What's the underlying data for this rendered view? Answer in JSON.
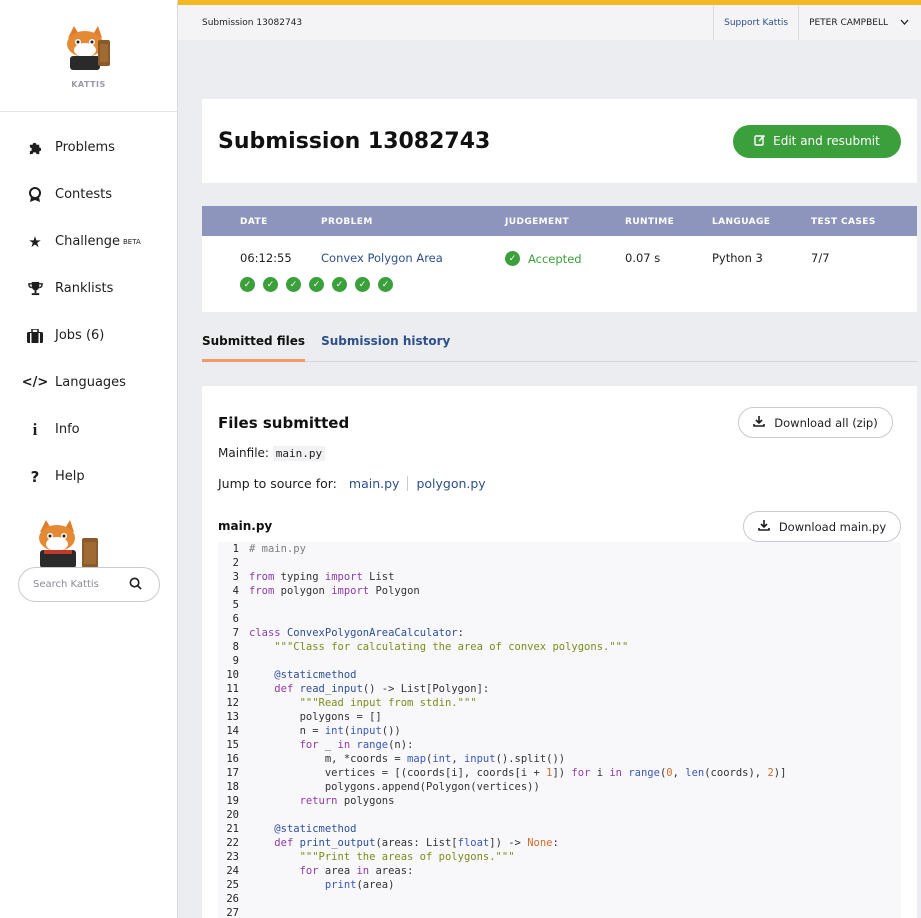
{
  "app": {
    "brand": "KATTIS"
  },
  "sidebar": {
    "items": [
      {
        "label": "Problems",
        "icon": "puzzle-icon"
      },
      {
        "label": "Contests",
        "icon": "award-icon"
      },
      {
        "label": "Challenge",
        "icon": "star-icon",
        "badge": "BETA"
      },
      {
        "label": "Ranklists",
        "icon": "trophy-icon"
      },
      {
        "label": "Jobs (6)",
        "icon": "briefcase-icon"
      },
      {
        "label": "Languages",
        "icon": "code-icon"
      },
      {
        "label": "Info",
        "icon": "info-icon"
      },
      {
        "label": "Help",
        "icon": "question-icon"
      }
    ],
    "search_placeholder": "Search Kattis"
  },
  "topbar": {
    "breadcrumb": "Submission 13082743",
    "support": "Support Kattis",
    "user": "PETER CAMPBELL"
  },
  "header": {
    "title": "Submission 13082743",
    "edit_button": "Edit and resubmit"
  },
  "table": {
    "headers": [
      "DATE",
      "PROBLEM",
      "JUDGEMENT",
      "RUNTIME",
      "LANGUAGE",
      "TEST CASES"
    ],
    "row": {
      "date": "06:12:55",
      "problem": "Convex Polygon Area",
      "judgement": "Accepted",
      "runtime": "0.07 s",
      "language": "Python 3",
      "test_cases": "7/7"
    },
    "tests_passed": 7
  },
  "tabs": [
    {
      "label": "Submitted files",
      "active": true
    },
    {
      "label": "Submission history",
      "active": false
    }
  ],
  "files": {
    "title": "Files submitted",
    "download_all": "Download all (zip)",
    "mainfile_label": "Mainfile:",
    "mainfile": "main.py",
    "jump_label": "Jump to source for:",
    "jump_files": [
      "main.py",
      "polygon.py"
    ],
    "current_file": "main.py",
    "download_file": "Download main.py"
  },
  "colors": {
    "accent": "#f3b824",
    "success": "#3b9f3b",
    "table_header": "#8d95bd",
    "link": "#2d4f8a",
    "tab_underline": "#f09a66"
  }
}
